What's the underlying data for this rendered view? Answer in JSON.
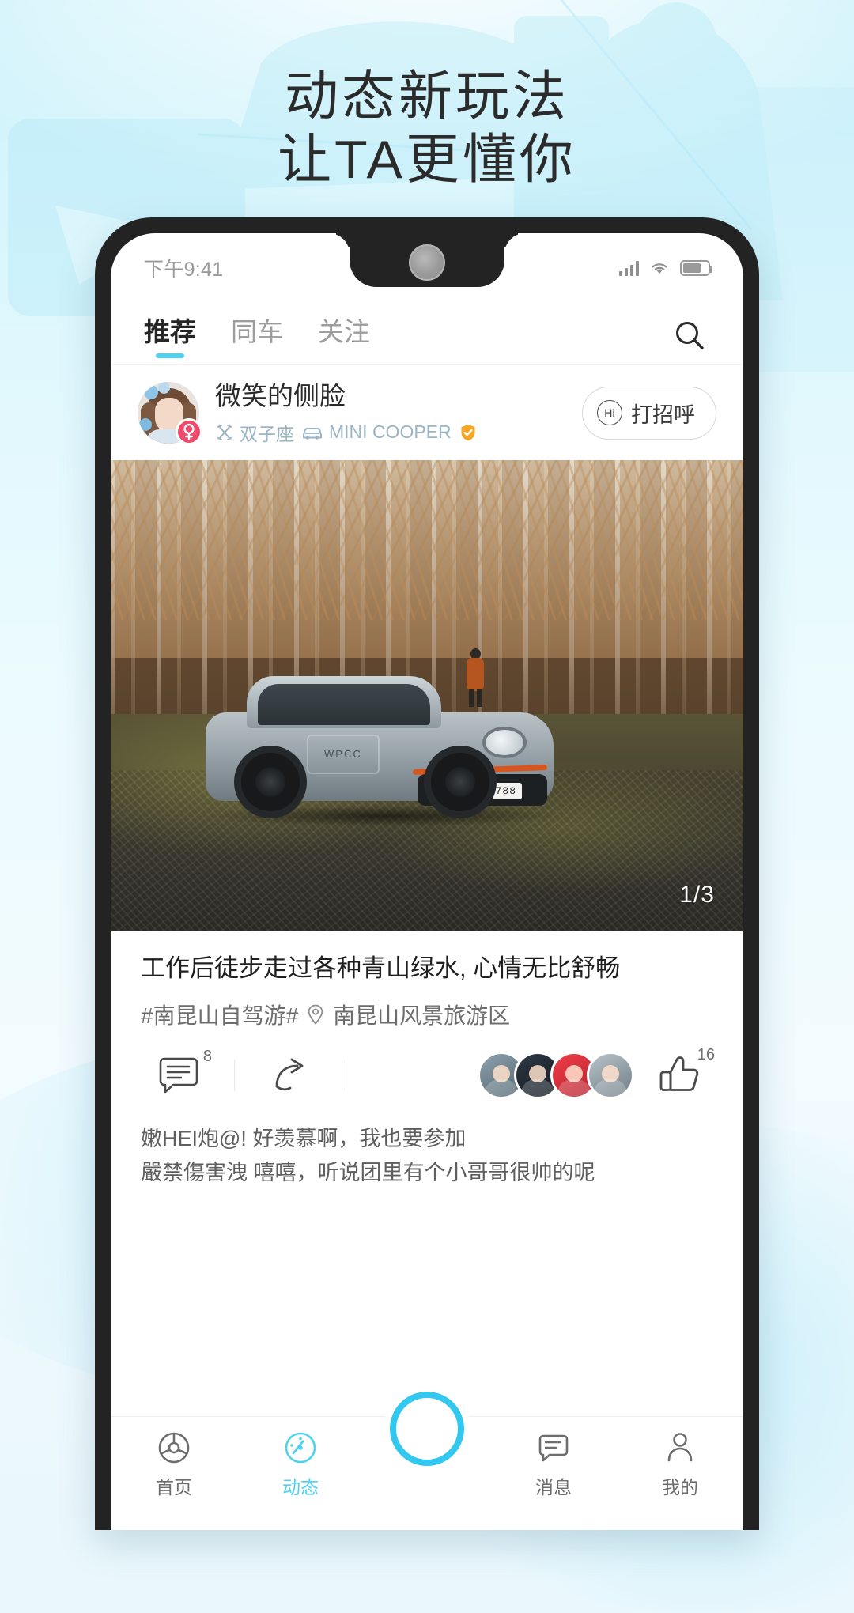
{
  "promo": {
    "headline_line1": "动态新玩法",
    "headline_line2": "让TA更懂你"
  },
  "statusbar": {
    "time": "下午9:41",
    "signal_icon": "signal-bars-icon",
    "wifi_icon": "wifi-icon",
    "battery_icon": "battery-icon"
  },
  "tabs": [
    {
      "label": "推荐",
      "active": true
    },
    {
      "label": "同车",
      "active": false
    },
    {
      "label": "关注",
      "active": false
    }
  ],
  "search": {
    "icon": "search-icon"
  },
  "user": {
    "name": "微笑的侧脸",
    "gender_icon": "female-icon",
    "zodiac_icon": "gemini-icon",
    "zodiac": "双子座",
    "car_icon": "car-icon",
    "car": "MINI COOPER",
    "verified_icon": "verified-badge-icon",
    "greet_label": "打招呼",
    "greet_icon_text": "Hi"
  },
  "photo": {
    "counter": "1/3",
    "plate": "1·URW·788",
    "car_decal": "WPCC"
  },
  "post": {
    "title": "工作后徒步走过各种青山绿水, 心情无比舒畅",
    "topic": "#南昆山自驾游#",
    "location_icon": "location-pin-icon",
    "location": "南昆山风景旅游区"
  },
  "actions": {
    "comment_icon": "comment-icon",
    "comment_count": "8",
    "share_icon": "share-icon",
    "like_icon": "thumbs-up-icon",
    "like_count": "16"
  },
  "comments": [
    {
      "who": "嫩HEI炮@!",
      "text": "好羡慕啊，我也要参加"
    },
    {
      "who": "嚴禁傷害洩",
      "text": "嘻嘻，听说团里有个小哥哥很帅的呢"
    }
  ],
  "bottomnav": [
    {
      "label": "首页",
      "icon": "steering-wheel-icon",
      "active": false
    },
    {
      "label": "动态",
      "icon": "speedometer-icon",
      "active": true
    },
    {
      "label": "",
      "icon": "record-ring-icon",
      "active": false
    },
    {
      "label": "消息",
      "icon": "message-icon",
      "active": false
    },
    {
      "label": "我的",
      "icon": "person-icon",
      "active": false
    }
  ],
  "colors": {
    "accent": "#4fd2f2",
    "accent_ring": "#32c8f0",
    "verified": "#f5a623",
    "female": "#ef4a6b",
    "page_bg": "#eaf8fd"
  }
}
